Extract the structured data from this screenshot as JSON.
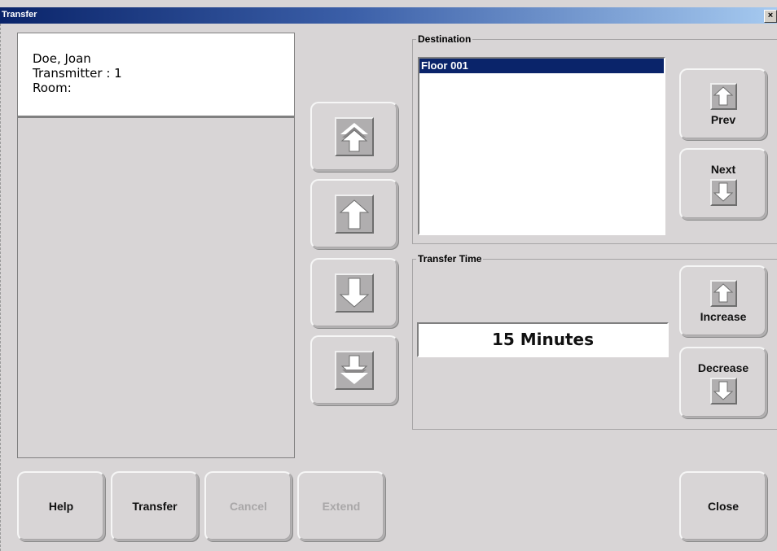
{
  "window": {
    "title": "Transfer",
    "close_glyph": "×"
  },
  "patient": {
    "name": "Doe, Joan",
    "transmitter": "Transmitter : 1",
    "room": "Room:"
  },
  "scroll_buttons": {
    "top": "page-up-icon",
    "up": "arrow-up-icon",
    "down": "arrow-down-icon",
    "bottom": "page-down-icon"
  },
  "destination": {
    "legend": "Destination",
    "items": [
      "Floor 001"
    ],
    "selected_index": 0,
    "prev_label": "Prev",
    "next_label": "Next"
  },
  "transfer_time": {
    "legend": "Transfer Time",
    "value": "15 Minutes",
    "increase_label": "Increase",
    "decrease_label": "Decrease"
  },
  "footer": {
    "help_label": "Help",
    "transfer_label": "Transfer",
    "cancel_label": "Cancel",
    "extend_label": "Extend",
    "close_label": "Close"
  },
  "colors": {
    "background": "#d8d5d6",
    "selection": "#0a246a",
    "titlebar_start": "#0a246a",
    "titlebar_end": "#a6caf0",
    "disabled_text": "#a9a7a8"
  }
}
